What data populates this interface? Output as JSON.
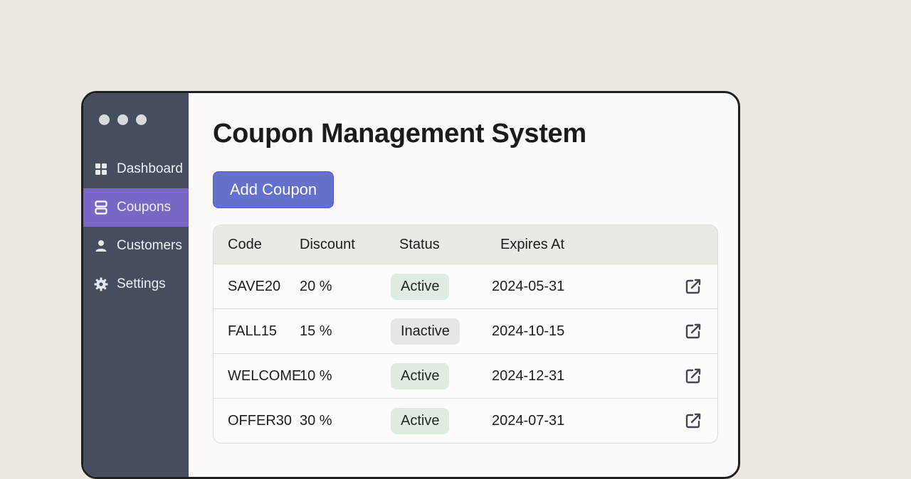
{
  "sidebar": {
    "items": [
      {
        "label": "Dashboard",
        "icon": "grid-icon",
        "active": false
      },
      {
        "label": "Coupons",
        "icon": "coupon-icon",
        "active": true
      },
      {
        "label": "Customers",
        "icon": "user-icon",
        "active": false
      },
      {
        "label": "Settings",
        "icon": "gear-icon",
        "active": false
      }
    ]
  },
  "main": {
    "title": "Coupon Management System",
    "add_button": "Add Coupon",
    "table": {
      "headers": [
        "Code",
        "Discount",
        "Status",
        "Expires At"
      ],
      "rows": [
        {
          "code": "SAVE20",
          "discount": "20 %",
          "status": "Active",
          "expires": "2024-05-31"
        },
        {
          "code": "FALL15",
          "discount": "15 %",
          "status": "Inactive",
          "expires": "2024-10-15"
        },
        {
          "code": "WELCOME",
          "discount": "10 %",
          "status": "Active",
          "expires": "2024-12-31"
        },
        {
          "code": "OFFER30",
          "discount": "30 %",
          "status": "Active",
          "expires": "2024-07-31"
        }
      ]
    }
  },
  "colors": {
    "sidebar_bg": "#454e5e",
    "active_nav": "#7a66c4",
    "button": "#6370cc",
    "active_badge": "#dfece1",
    "inactive_badge": "#e8e6e3"
  }
}
